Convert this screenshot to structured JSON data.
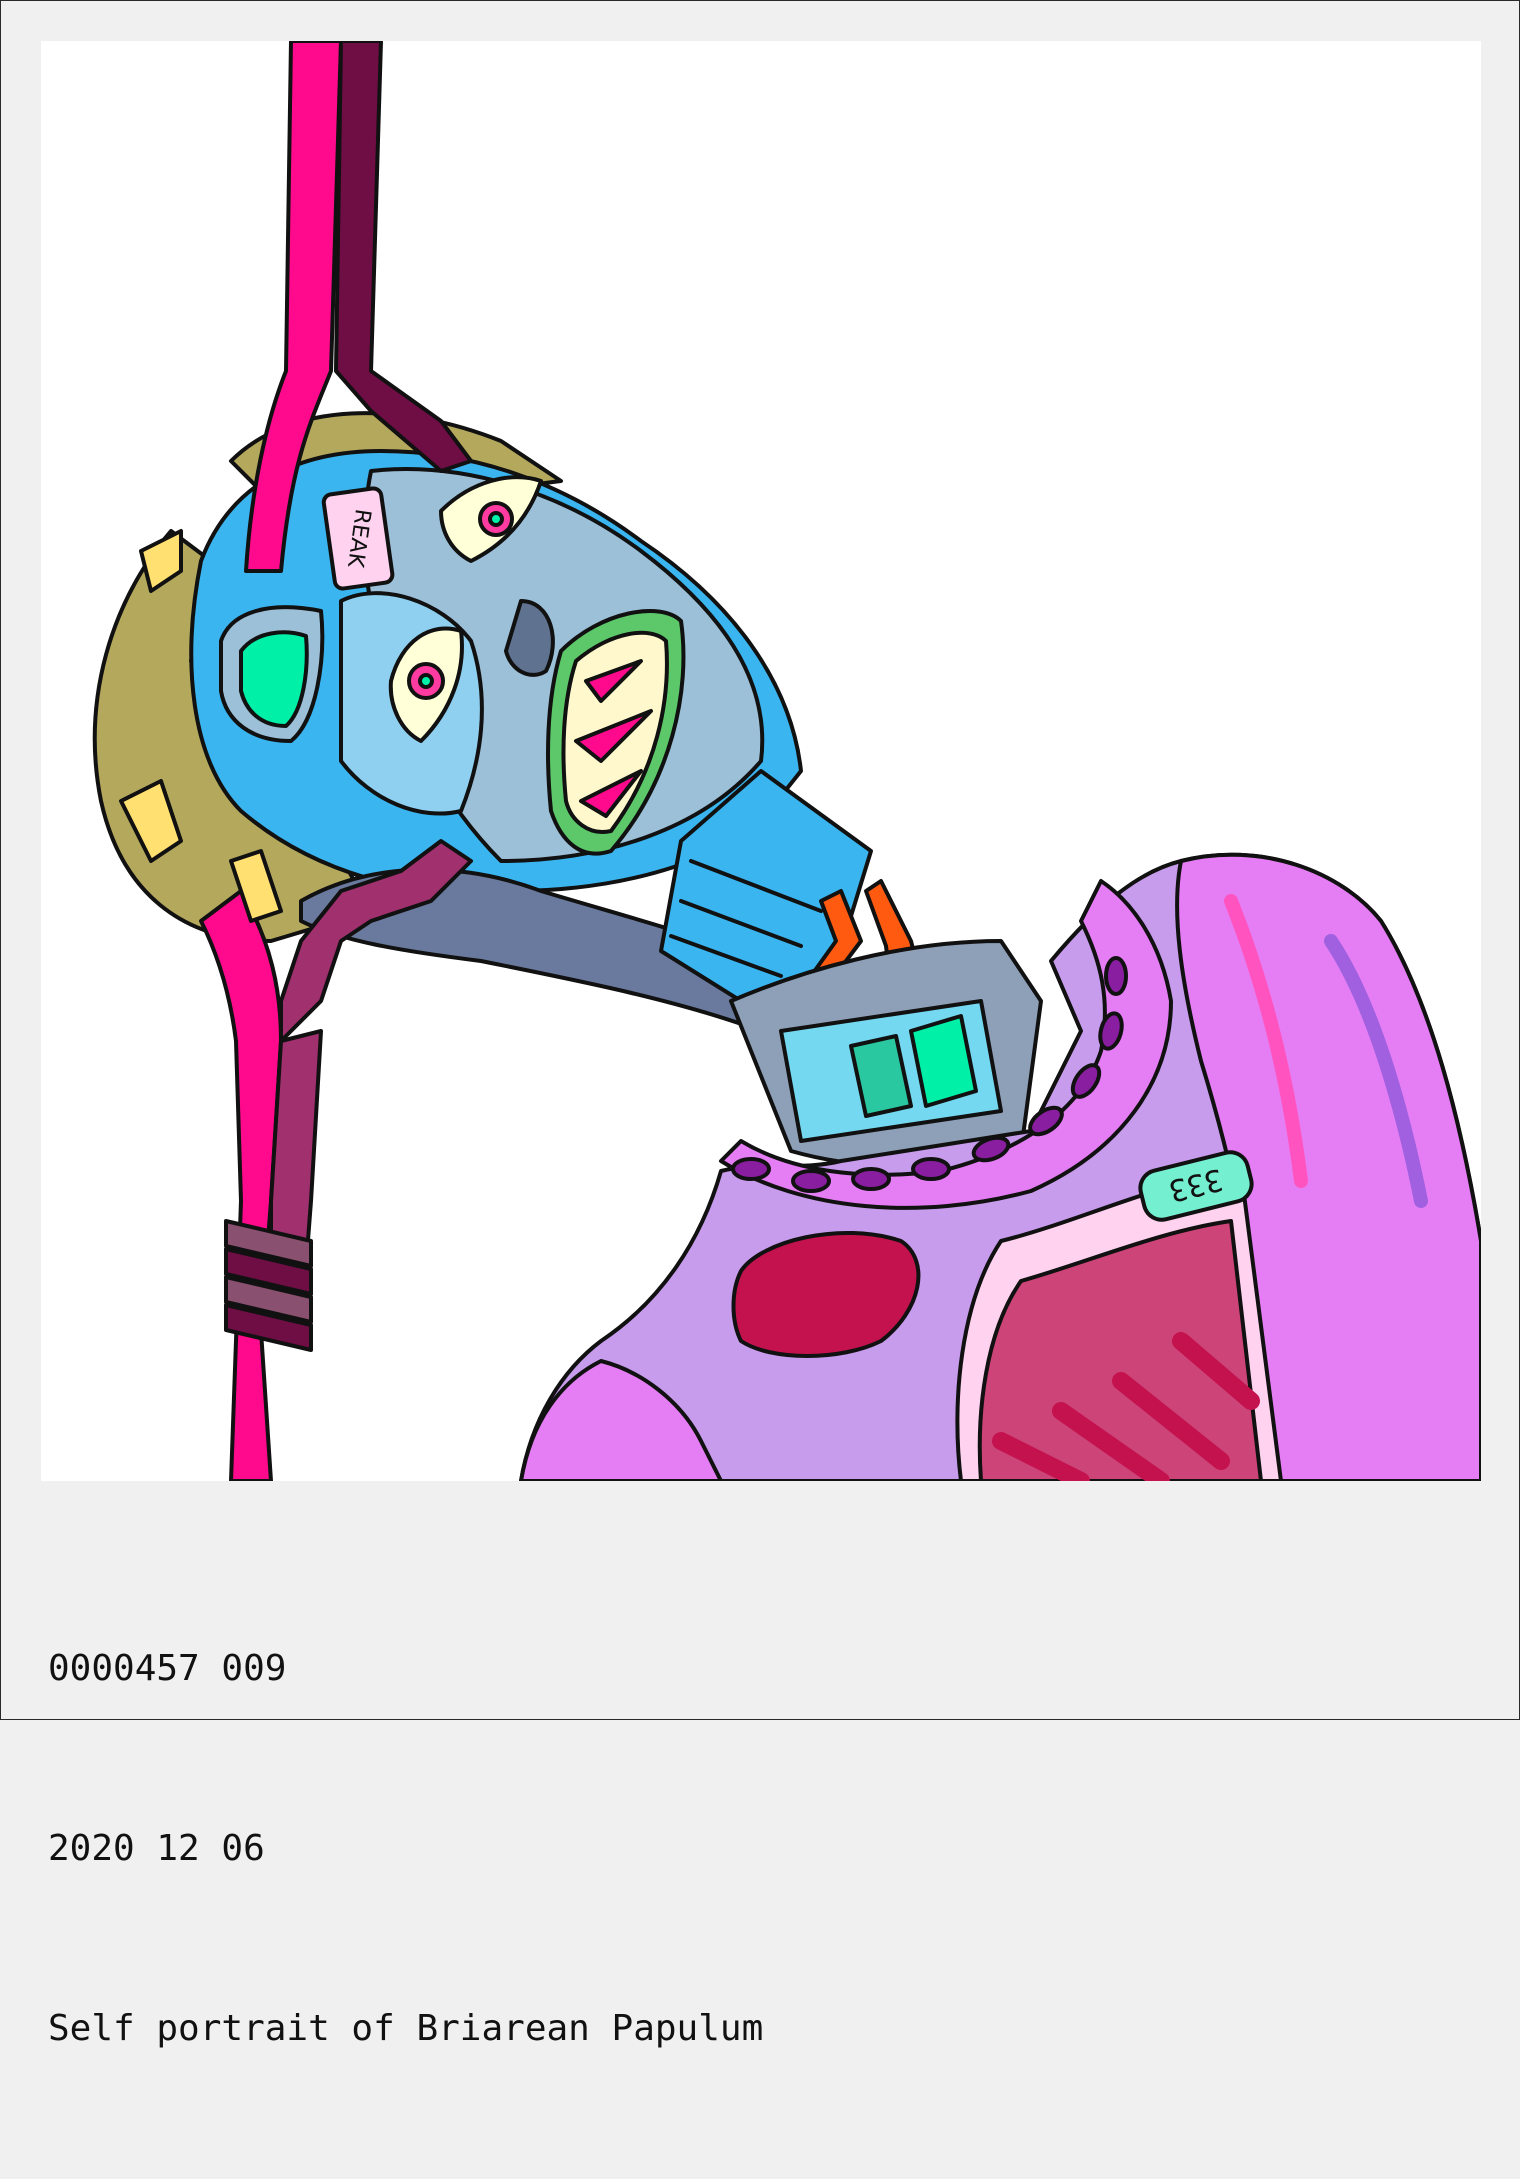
{
  "caption": {
    "id_line": "0000457 009",
    "date_line": "2020 12 06",
    "title_line": "Self portrait of Briarean Papulum"
  },
  "artwork": {
    "labels": {
      "forehead_tag": "ꓘꓯꓱꓤ",
      "chest_tag": "333"
    },
    "palette": {
      "magenta": "#ff0a8c",
      "maroon": "#6e0e45",
      "sky_blue": "#3ab5f0",
      "steel": "#5f7290",
      "olive": "#b4a85c",
      "mint": "#00f0a8",
      "lavender": "#c79cec",
      "violet": "#e57ef4",
      "crimson": "#c4124e",
      "orange": "#ff5a10"
    }
  }
}
